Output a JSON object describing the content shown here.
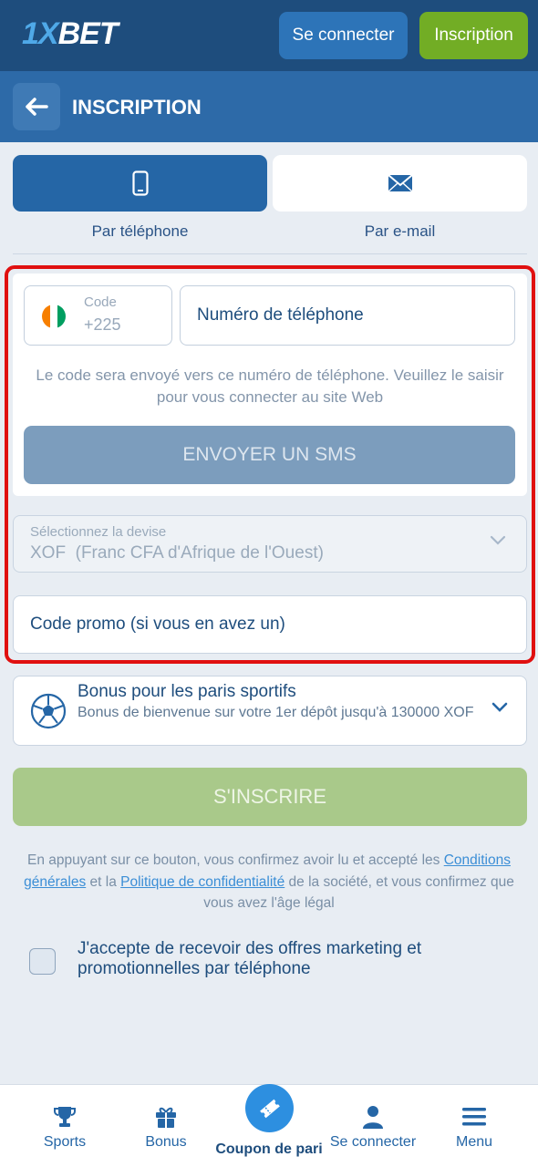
{
  "topbar": {
    "logo_prefix": "1X",
    "logo_suffix": "BET",
    "login_label": "Se connecter",
    "signup_label": "Inscription"
  },
  "header": {
    "title": "INSCRIPTION"
  },
  "tabs": [
    {
      "label": "Par téléphone",
      "icon": "phone-icon",
      "active": true
    },
    {
      "label": "Par e-mail",
      "icon": "envelope-icon",
      "active": false
    }
  ],
  "phone_form": {
    "code_label": "Code",
    "code_value": "+225",
    "phone_placeholder": "Numéro de téléphone",
    "info": "Le code sera envoyé vers ce numéro de téléphone. Veuillez le saisir pour vous connecter au site Web",
    "sms_button": "ENVOYER UN SMS"
  },
  "currency": {
    "label": "Sélectionnez la devise",
    "value": "XOF  (Franc CFA d'Afrique de l'Ouest)"
  },
  "promo": {
    "placeholder": "Code promo (si vous en avez un)"
  },
  "bonus": {
    "title": "Bonus pour les paris sportifs",
    "description": "Bonus de bienvenue sur votre 1er dépôt jusqu'à 130000 XOF"
  },
  "register_button": "S'INSCRIRE",
  "legal": {
    "part1": "En appuyant sur ce bouton, vous confirmez avoir lu et accepté les ",
    "link1": "Conditions générales",
    "part2": " et la ",
    "link2": "Politique de confidentialité",
    "part3": " de la société, et vous confirmez que vous avez l'âge légal"
  },
  "marketing_checkbox": {
    "label": "J'accepte de recevoir des offres marketing et promotionnelles par téléphone",
    "checked": false
  },
  "bottom_nav": {
    "sports": "Sports",
    "bonus": "Bonus",
    "coupon": "Coupon de pari",
    "login": "Se connecter",
    "menu": "Menu"
  },
  "colors": {
    "topbar": "#1e4d7d",
    "header": "#2d6aa8",
    "accent_green": "#72ad25",
    "highlight_frame": "#e01010"
  }
}
